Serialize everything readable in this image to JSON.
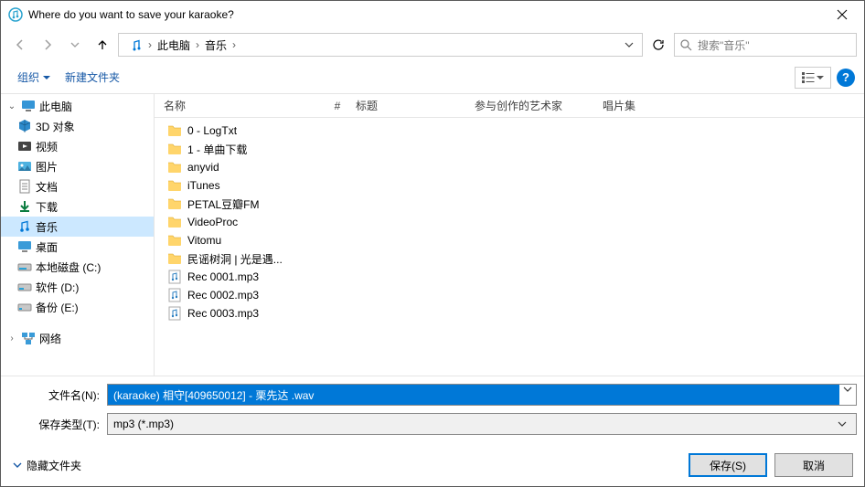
{
  "window": {
    "title": "Where do you want to save your karaoke?"
  },
  "breadcrumb": {
    "root": "此电脑",
    "item2": "音乐"
  },
  "search": {
    "placeholder": "搜索\"音乐\""
  },
  "toolbar": {
    "organize": "组织",
    "newfolder": "新建文件夹"
  },
  "columns": {
    "name": "名称",
    "num": "#",
    "title": "标题",
    "artist": "参与创作的艺术家",
    "album": "唱片集"
  },
  "sidebar": {
    "pc": "此电脑",
    "objects3d": "3D 对象",
    "video": "视频",
    "pictures": "图片",
    "documents": "文档",
    "downloads": "下载",
    "music": "音乐",
    "desktop": "桌面",
    "diskC": "本地磁盘 (C:)",
    "diskD": "软件 (D:)",
    "diskE": "备份 (E:)",
    "network": "网络"
  },
  "files": [
    {
      "type": "folder",
      "name": "0 - LogTxt"
    },
    {
      "type": "folder",
      "name": "1 - 单曲下载"
    },
    {
      "type": "folder",
      "name": "anyvid"
    },
    {
      "type": "folder",
      "name": "iTunes"
    },
    {
      "type": "folder",
      "name": "PETAL豆瓣FM"
    },
    {
      "type": "folder",
      "name": "VideoProc"
    },
    {
      "type": "folder",
      "name": "Vitomu"
    },
    {
      "type": "folder",
      "name": "民谣树洞 | 光是遇..."
    },
    {
      "type": "audio",
      "name": "Rec 0001.mp3"
    },
    {
      "type": "audio",
      "name": "Rec 0002.mp3"
    },
    {
      "type": "audio",
      "name": "Rec 0003.mp3"
    }
  ],
  "form": {
    "filename_label": "文件名(N):",
    "filename_value": "(karaoke) 相守[409650012] - 栗先达 .wav",
    "filetype_label": "保存类型(T):",
    "filetype_value": "mp3 (*.mp3)"
  },
  "footer": {
    "hide": "隐藏文件夹",
    "save": "保存(S)",
    "cancel": "取消"
  }
}
